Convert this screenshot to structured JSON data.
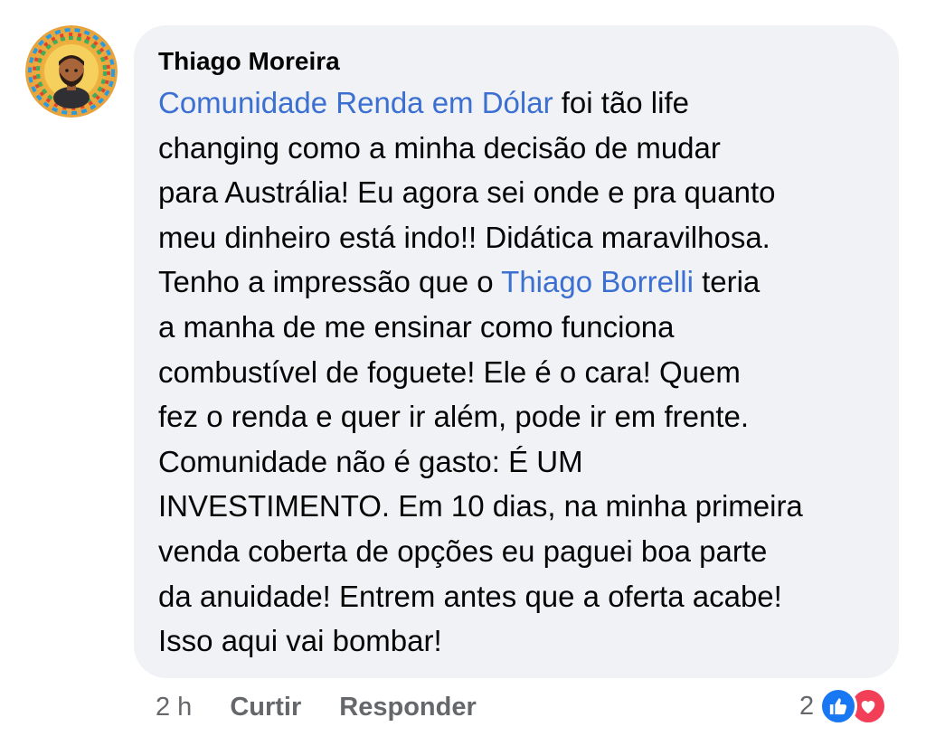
{
  "comment": {
    "author": "Thiago Moreira",
    "segments": [
      {
        "type": "mention",
        "text": "Comunidade Renda em Dólar"
      },
      {
        "type": "text",
        "text": " foi tão life\nchanging como a minha decisão de mudar\npara Austrália! Eu agora sei onde e pra quanto\nmeu dinheiro está indo!! Didática maravilhosa.\nTenho a impressão que o "
      },
      {
        "type": "mention",
        "text": "Thiago Borrelli"
      },
      {
        "type": "text",
        "text": " teria\na manha de me ensinar como funciona\ncombustível de foguete! Ele é o cara! Quem\nfez o renda e quer ir além, pode ir em frente.\nComunidade não é gasto: É UM\nINVESTIMENTO. Em 10 dias, na minha primeira\nvenda coberta de opções eu paguei boa parte\nda anuidade! Entrem antes que a oferta acabe!\nIsso aqui vai bombar!"
      }
    ]
  },
  "actions": {
    "time": "2 h",
    "like_label": "Curtir",
    "reply_label": "Responder"
  },
  "reactions": {
    "count": "2",
    "icons": [
      "like-icon",
      "love-icon"
    ]
  },
  "colors": {
    "mention": "#3b6fd1",
    "bubble": "#f0f2f5",
    "like": "#1877f2",
    "love": "#f33e58",
    "meta_text": "#65676b"
  }
}
